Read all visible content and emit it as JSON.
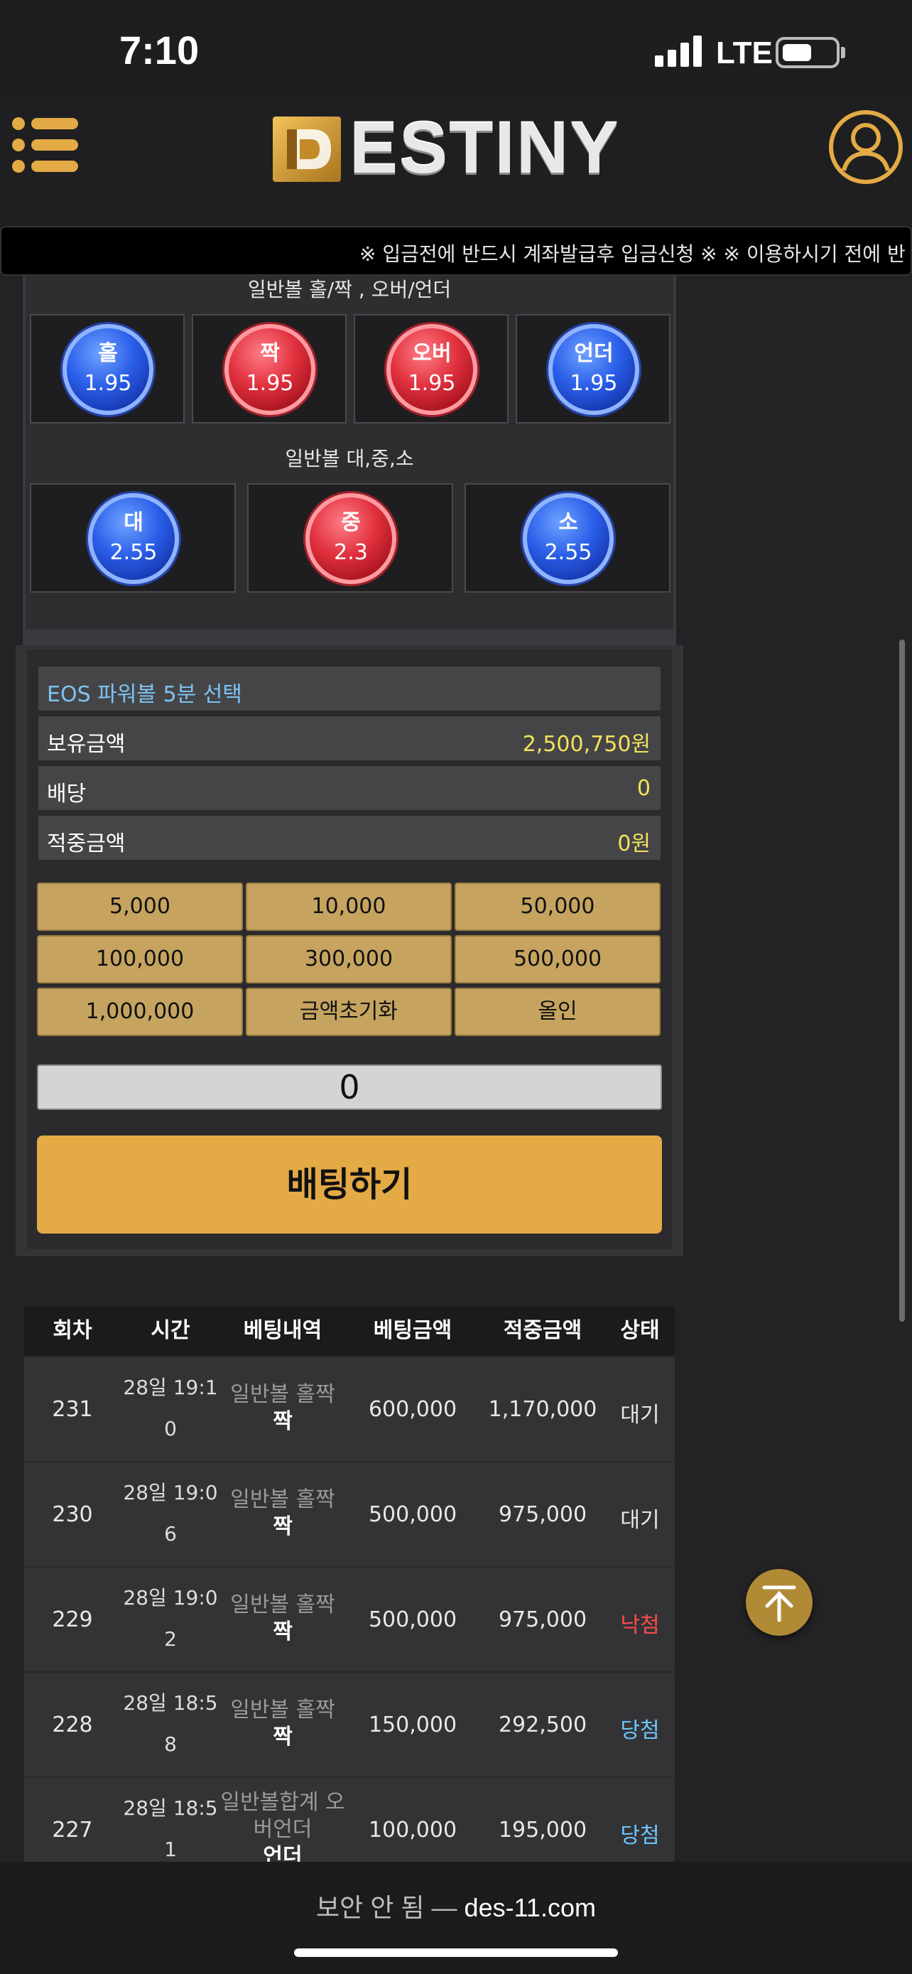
{
  "status": {
    "time": "7:10",
    "network": "LTE"
  },
  "header": {
    "logo_text": "ESTINY"
  },
  "ticker": {
    "text": "※ 입금전에 반드시 계좌발급후 입금신청 ※ ※ 이용하시기 전에 반"
  },
  "oddeven": {
    "title": "일반볼 홀/짝 , 오버/언더",
    "balls": [
      {
        "label": "홀",
        "odds": "1.95",
        "color": "blue"
      },
      {
        "label": "짝",
        "odds": "1.95",
        "color": "red"
      },
      {
        "label": "오버",
        "odds": "1.95",
        "color": "red"
      },
      {
        "label": "언더",
        "odds": "1.95",
        "color": "blue"
      }
    ]
  },
  "size": {
    "title": "일반볼 대,중,소",
    "balls": [
      {
        "label": "대",
        "odds": "2.55",
        "color": "blue"
      },
      {
        "label": "중",
        "odds": "2.3",
        "color": "red"
      },
      {
        "label": "소",
        "odds": "2.55",
        "color": "blue"
      }
    ]
  },
  "form": {
    "game_title": "EOS 파워볼 5분 선택",
    "balance_label": "보유금액",
    "balance_value": "2,500,750원",
    "payout_label": "배당",
    "payout_value": "0",
    "win_label": "적중금액",
    "win_value": "0원",
    "chips": [
      "5,000",
      "10,000",
      "50,000",
      "100,000",
      "300,000",
      "500,000",
      "1,000,000",
      "금액초기화",
      "올인"
    ],
    "amount": "0",
    "bet_button": "배팅하기"
  },
  "history": {
    "headers": [
      "회차",
      "시간",
      "베팅내역",
      "베팅금액",
      "적중금액",
      "상태"
    ],
    "rows": [
      {
        "round": "231",
        "time1": "28일 19:1",
        "time2": "0",
        "detail1": "일반볼 홀짝",
        "detail2": "짝",
        "bet": "600,000",
        "win": "1,170,000",
        "status": "대기",
        "status_color": "#e8e8e8"
      },
      {
        "round": "230",
        "time1": "28일 19:0",
        "time2": "6",
        "detail1": "일반볼 홀짝",
        "detail2": "짝",
        "bet": "500,000",
        "win": "975,000",
        "status": "대기",
        "status_color": "#e8e8e8"
      },
      {
        "round": "229",
        "time1": "28일 19:0",
        "time2": "2",
        "detail1": "일반볼 홀짝",
        "detail2": "짝",
        "bet": "500,000",
        "win": "975,000",
        "status": "낙첨",
        "status_color": "#ff4a4a"
      },
      {
        "round": "228",
        "time1": "28일 18:5",
        "time2": "8",
        "detail1": "일반볼 홀짝",
        "detail2": "짝",
        "bet": "150,000",
        "win": "292,500",
        "status": "당첨",
        "status_color": "#6ec6ff"
      },
      {
        "round": "227",
        "time1": "28일 18:5",
        "time2": "1",
        "detail1": "일반볼합계 오버언더",
        "detail2": "언더",
        "bet": "100,000",
        "win": "195,000",
        "status": "당첨",
        "status_color": "#6ec6ff"
      }
    ]
  },
  "browser": {
    "security": "보안 안 됨 —",
    "domain": "des-11.com"
  },
  "icons": {
    "menu": "menu-icon",
    "user": "user-icon",
    "scroll_top": "arrow-up-icon"
  }
}
